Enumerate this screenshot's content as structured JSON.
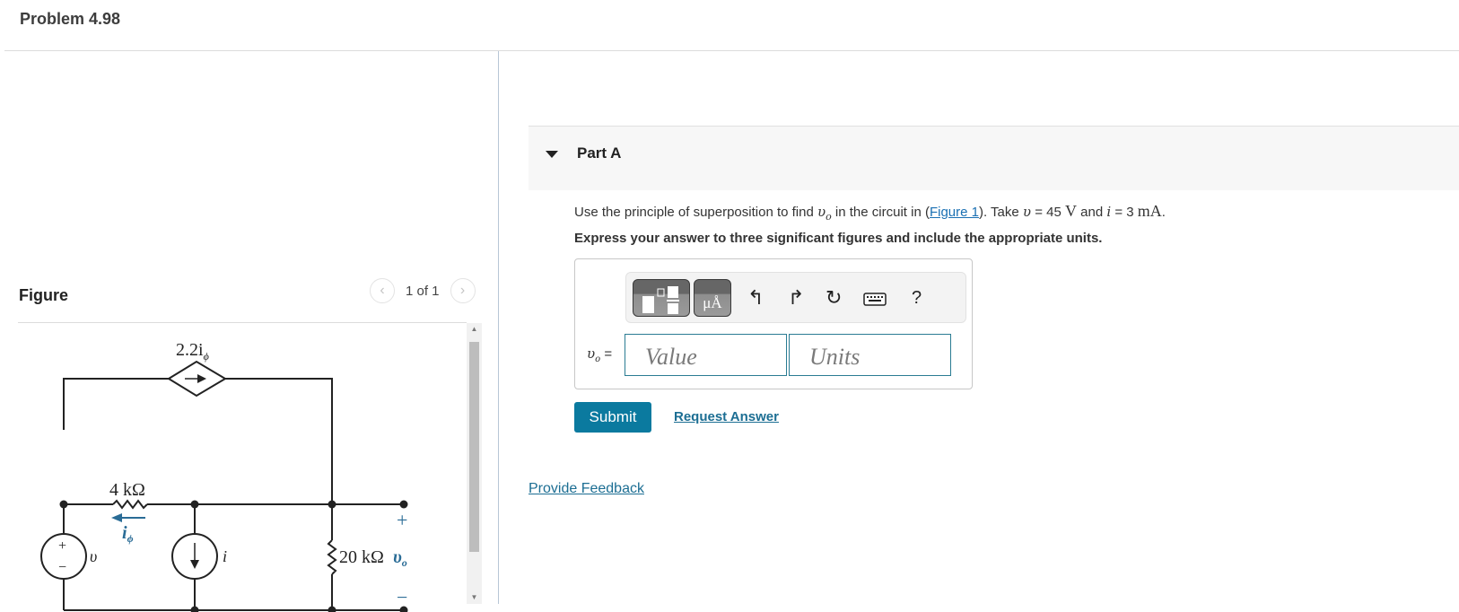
{
  "header": {
    "title": "Problem 4.98"
  },
  "figure_panel": {
    "label": "Figure",
    "pager": {
      "prev_icon": "chevron-left-icon",
      "count": "1 of 1",
      "next_icon": "chevron-right-icon"
    },
    "circuit": {
      "dependent_source": "2.2i",
      "dependent_source_sub": "ϕ",
      "resistor_1": "4 kΩ",
      "current_label": "i",
      "current_label_sub": "ϕ",
      "voltage_source": "υ",
      "current_source": "i",
      "resistor_2": "20 kΩ",
      "output_label": "υ",
      "output_label_sub": "o",
      "plus": "+",
      "minus": "−",
      "source_plus": "+",
      "source_minus": "−"
    }
  },
  "part": {
    "title": "Part A",
    "question": {
      "pre": "Use the principle of superposition to find ",
      "var": "υ",
      "var_sub": "o",
      "mid": " in the circuit in (",
      "link": "Figure 1",
      "post": "). Take ",
      "v_sym": "υ",
      "v_eq": " = 45 ",
      "v_unit": "V",
      "and": " and ",
      "i_sym": "i",
      "i_eq": " = 3 ",
      "i_unit": "mA",
      "end": "."
    },
    "instruction": "Express your answer to three significant figures and include the appropriate units.",
    "toolbar": {
      "templates_icon": "templates-icon",
      "units_label": "μÅ",
      "undo_icon": "undo-icon",
      "redo_icon": "redo-icon",
      "reset_icon": "reset-icon",
      "keyboard_icon": "keyboard-icon",
      "help_label": "?"
    },
    "answer": {
      "var": "υ",
      "var_sub": "o",
      "eq": " =",
      "value_placeholder": "Value",
      "units_placeholder": "Units"
    },
    "submit_label": "Submit",
    "request_label": "Request Answer"
  },
  "feedback_label": "Provide Feedback",
  "colors": {
    "accent": "#0b7a9f",
    "link": "#1c6e93",
    "circuit_blue": "#2a6c96"
  }
}
